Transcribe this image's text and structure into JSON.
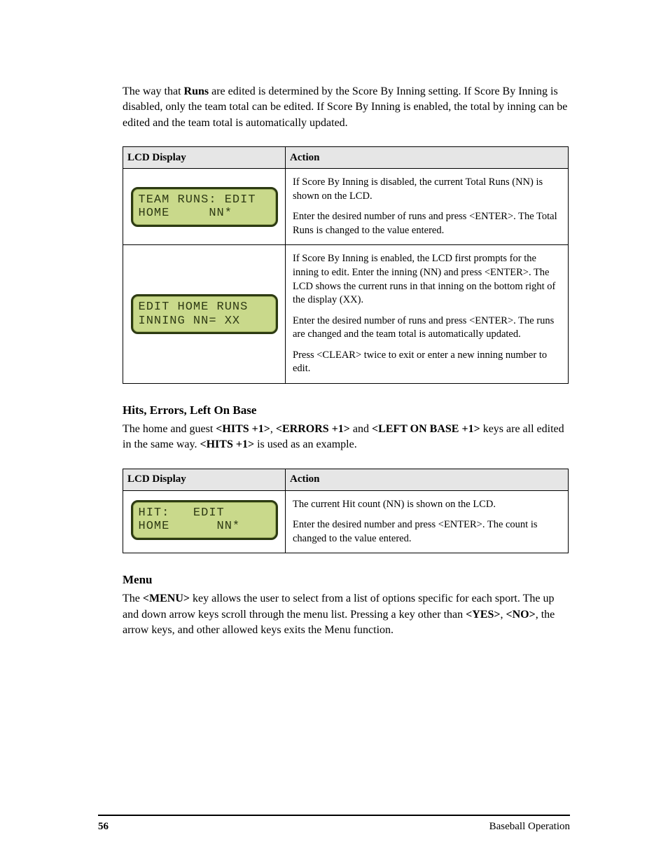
{
  "intro": {
    "pre": "The way that ",
    "bold": "Runs",
    "post": " are edited is determined by the Score By Inning setting. If Score By Inning is disabled, only the team total can be edited. If Score By Inning is enabled, the total by inning can be edited and the team total is automatically updated."
  },
  "table1": {
    "head_left": "LCD Display",
    "head_right": "Action",
    "row1": {
      "lcd": "TEAM RUNS: EDIT\nHOME     NN*",
      "act1_pre": "If Score By Inning is disabled, the current Total Runs (",
      "act1_bold": "NN",
      "act1_post": ") is shown on the LCD.",
      "act2_pre": "Enter the desired number of runs and press ",
      "act2_bold": "<ENTER>",
      "act2_post": ". The Total Runs is changed to the value entered."
    },
    "row2": {
      "lcd": "EDIT HOME RUNS\nINNING NN= XX",
      "act1_pre": "If Score By Inning is enabled, the LCD first prompts for the inning to edit. Enter the inning (",
      "act1_b1": "NN",
      "act1_mid1": ") and press ",
      "act1_b2": "<ENTER>",
      "act1_mid2": ". The LCD shows the current runs in that inning on the bottom right of the display (",
      "act1_b3": "XX",
      "act1_post": ").",
      "act2_pre": "Enter the desired number of runs and press ",
      "act2_bold": "<ENTER>",
      "act2_post": ". The runs are changed and the team total is automatically updated.",
      "act3_pre": "Press ",
      "act3_bold": "<CLEAR>",
      "act3_post": " twice to exit or enter a new inning number to edit."
    }
  },
  "section1": {
    "heading": "Hits, Errors, Left On Base",
    "p_pre": "The home and guest ",
    "p_b1": "<HITS +1>",
    "p_s1": ", ",
    "p_b2": "<ERRORS +1>",
    "p_s2": " and ",
    "p_b3": "<LEFT ON BASE +1>",
    "p_s3": " keys are all edited in the same way. ",
    "p_b4": "<HITS +1>",
    "p_s4": " is used as an example."
  },
  "table2": {
    "head_left": "LCD Display",
    "head_right": "Action",
    "row1": {
      "lcd": "HIT:   EDIT\nHOME      NN*",
      "act1_pre": "The current Hit count (",
      "act1_bold": "NN",
      "act1_post": ") is shown on the LCD.",
      "act2_pre": "Enter the desired number and press ",
      "act2_bold": "<ENTER>",
      "act2_post": ". The count is changed to the value entered."
    }
  },
  "section2": {
    "heading": "Menu",
    "p_pre": "The ",
    "p_b1": "<MENU>",
    "p_s1": " key allows the user to select from a list of options specific for each sport. The up and down arrow keys scroll through the menu list. Pressing a key other than ",
    "p_b2": "<YES>",
    "p_s2": ", ",
    "p_b3": "<NO>",
    "p_s3": ", the arrow keys, and other allowed keys exits the Menu function."
  },
  "footer": {
    "left": "56",
    "right": "Baseball Operation"
  }
}
